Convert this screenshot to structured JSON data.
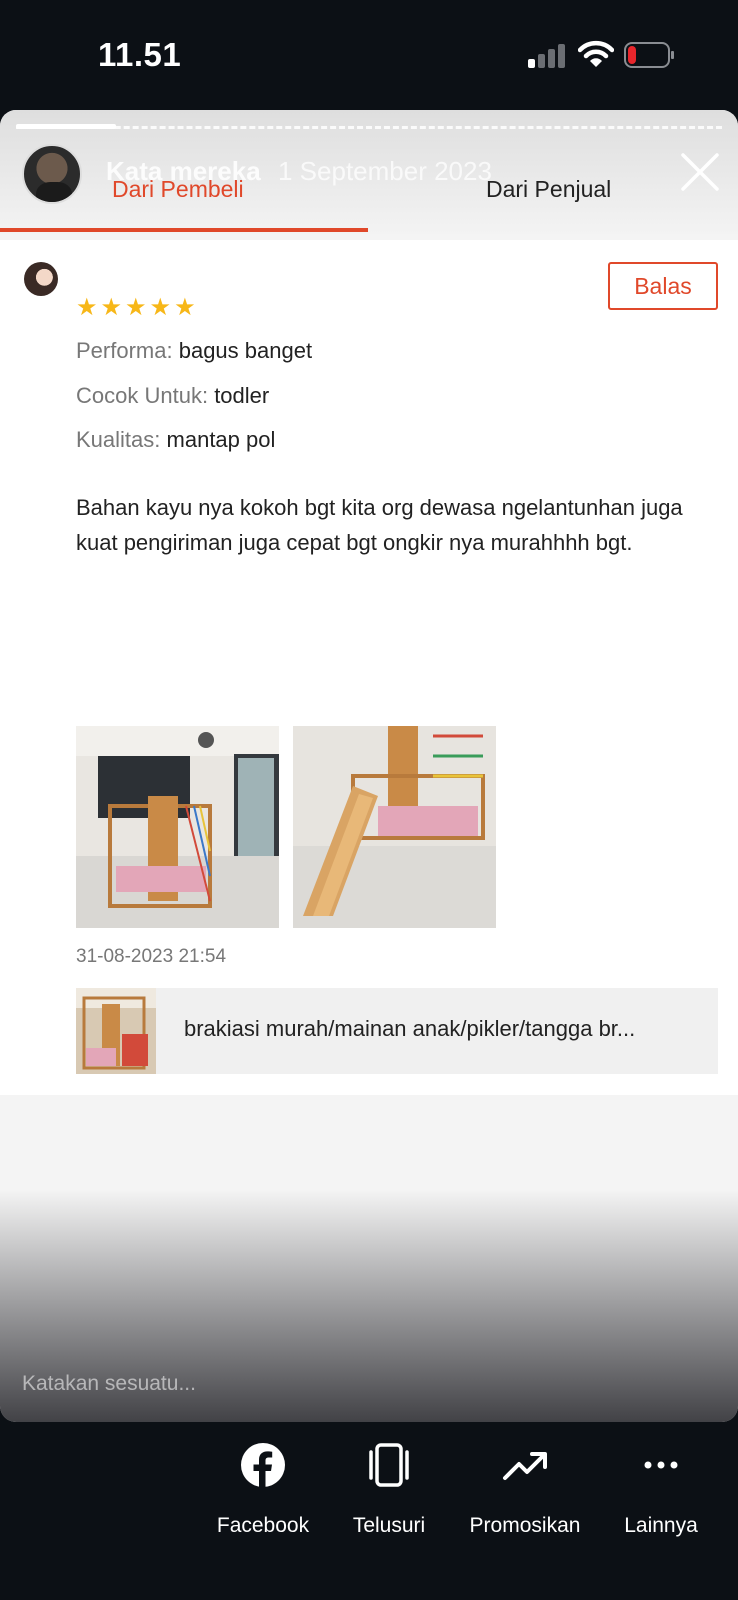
{
  "status_bar": {
    "time": "11.51",
    "signal_bars": 1,
    "battery_level": 0.15
  },
  "story": {
    "user_name": "Kata mereka",
    "date": "1 September 2023",
    "progress_fraction": 0.15,
    "comment_placeholder": "Katakan sesuatu..."
  },
  "tabs": [
    {
      "label": "Dari Pembeli",
      "active": true
    },
    {
      "label": "Dari Penjual",
      "active": false
    }
  ],
  "review": {
    "rating": 5,
    "reply_label": "Balas",
    "attributes": [
      {
        "key": "Performa:",
        "value": "bagus banget"
      },
      {
        "key": "Cocok Untuk:",
        "value": "todler"
      },
      {
        "key": "Kualitas:",
        "value": "mantap pol"
      }
    ],
    "text": "Bahan kayu nya kokoh bgt kita org dewasa ngelantunhan juga kuat pengiriman juga cepat bgt ongkir nya murahhhh bgt.",
    "date": "31-08-2023 21:54",
    "product_name": "brakiasi murah/mainan anak/pikler/tangga br..."
  },
  "share": [
    {
      "label": "Facebook",
      "icon": "facebook-icon"
    },
    {
      "label": "Telusuri",
      "icon": "device-icon"
    },
    {
      "label": "Promosikan",
      "icon": "trending-up-icon"
    },
    {
      "label": "Lainnya",
      "icon": "more-icon"
    }
  ],
  "colors": {
    "accent": "#e0482a",
    "star": "#f7b718",
    "background": "#0c1015"
  }
}
